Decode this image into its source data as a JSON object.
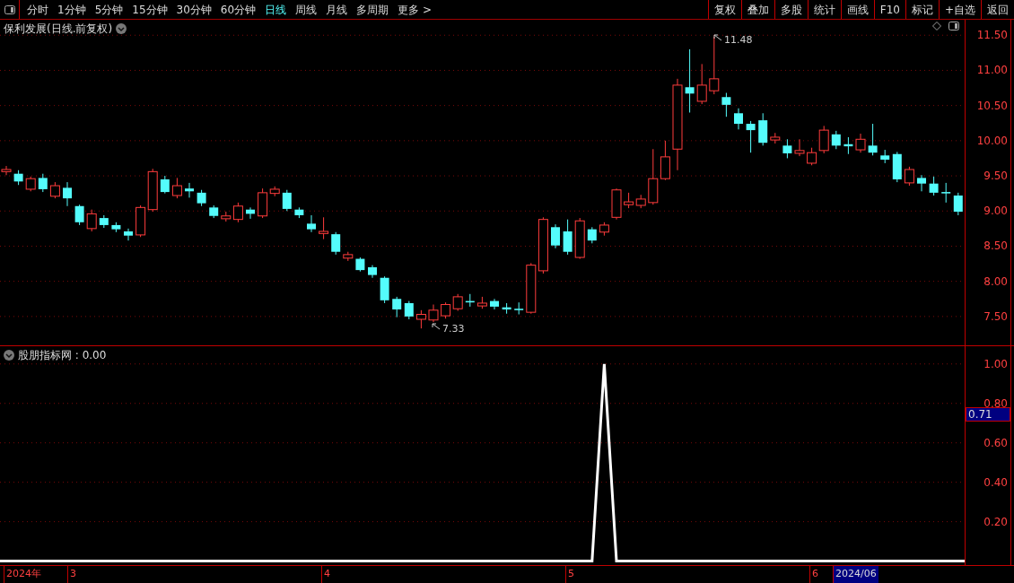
{
  "toolbar": {
    "periods": [
      {
        "label": "分时",
        "selected": false
      },
      {
        "label": "1分钟",
        "selected": false
      },
      {
        "label": "5分钟",
        "selected": false
      },
      {
        "label": "15分钟",
        "selected": false
      },
      {
        "label": "30分钟",
        "selected": false
      },
      {
        "label": "60分钟",
        "selected": false
      },
      {
        "label": "日线",
        "selected": true
      },
      {
        "label": "周线",
        "selected": false
      },
      {
        "label": "月线",
        "selected": false
      },
      {
        "label": "多周期",
        "selected": false
      },
      {
        "label": "更多 >",
        "selected": false
      }
    ],
    "actions": [
      "复权",
      "叠加",
      "多股",
      "统计",
      "画线",
      "F10",
      "标记",
      "+自选",
      "返回"
    ]
  },
  "price_chart": {
    "title": "保利发展(日线.前复权)",
    "high_marker": "11.48",
    "low_marker": "7.33",
    "chart_data": {
      "type": "candlestick",
      "grid": true,
      "ylim": [
        7.09,
        11.72
      ],
      "yticks": [
        {
          "value": 11.5,
          "label": "11.50"
        },
        {
          "value": 11,
          "label": "11.00"
        },
        {
          "value": 10.5,
          "label": "10.50"
        },
        {
          "value": 10,
          "label": "10.00"
        },
        {
          "value": 9.5,
          "label": "9.50"
        },
        {
          "value": 9,
          "label": "9.00"
        },
        {
          "value": 8.5,
          "label": "8.50"
        },
        {
          "value": 8,
          "label": "8.00"
        },
        {
          "value": 7.5,
          "label": "7.50"
        }
      ],
      "ohlc": [
        [
          9.56,
          9.64,
          9.51,
          9.59
        ],
        [
          9.53,
          9.58,
          9.37,
          9.42
        ],
        [
          9.31,
          9.49,
          9.28,
          9.46
        ],
        [
          9.47,
          9.53,
          9.27,
          9.31
        ],
        [
          9.21,
          9.41,
          9.18,
          9.36
        ],
        [
          9.33,
          9.41,
          9.07,
          9.18
        ],
        [
          9.07,
          9.09,
          8.8,
          8.84
        ],
        [
          8.75,
          9.02,
          8.71,
          8.96
        ],
        [
          8.9,
          8.94,
          8.76,
          8.8
        ],
        [
          8.8,
          8.84,
          8.7,
          8.74
        ],
        [
          8.71,
          8.75,
          8.58,
          8.65
        ],
        [
          8.66,
          9.08,
          8.63,
          9.05
        ],
        [
          9.02,
          9.6,
          8.99,
          9.56
        ],
        [
          9.45,
          9.5,
          9.25,
          9.27
        ],
        [
          9.22,
          9.47,
          9.18,
          9.36
        ],
        [
          9.32,
          9.4,
          9.19,
          9.28
        ],
        [
          9.26,
          9.3,
          9.07,
          9.11
        ],
        [
          9.05,
          9.08,
          8.9,
          8.93
        ],
        [
          8.89,
          8.99,
          8.85,
          8.93
        ],
        [
          8.88,
          9.12,
          8.84,
          9.07
        ],
        [
          9.02,
          9.05,
          8.89,
          8.96
        ],
        [
          8.93,
          9.32,
          8.9,
          9.26
        ],
        [
          9.25,
          9.35,
          9.21,
          9.31
        ],
        [
          9.26,
          9.3,
          9.0,
          9.03
        ],
        [
          9.02,
          9.05,
          8.9,
          8.94
        ],
        [
          8.82,
          8.94,
          8.7,
          8.74
        ],
        [
          8.68,
          8.91,
          8.6,
          8.71
        ],
        [
          8.67,
          8.7,
          8.38,
          8.42
        ],
        [
          8.33,
          8.42,
          8.29,
          8.38
        ],
        [
          8.32,
          8.34,
          8.14,
          8.16
        ],
        [
          8.2,
          8.23,
          8.05,
          8.09
        ],
        [
          8.05,
          8.07,
          7.69,
          7.73
        ],
        [
          7.75,
          7.78,
          7.49,
          7.6
        ],
        [
          7.69,
          7.72,
          7.46,
          7.5
        ],
        [
          7.46,
          7.59,
          7.33,
          7.53
        ],
        [
          7.45,
          7.67,
          7.42,
          7.59
        ],
        [
          7.51,
          7.7,
          7.47,
          7.67
        ],
        [
          7.61,
          7.82,
          7.58,
          7.78
        ],
        [
          7.72,
          7.82,
          7.64,
          7.7
        ],
        [
          7.65,
          7.78,
          7.61,
          7.69
        ],
        [
          7.72,
          7.75,
          7.6,
          7.64
        ],
        [
          7.63,
          7.69,
          7.54,
          7.6
        ],
        [
          7.61,
          7.7,
          7.53,
          7.59
        ],
        [
          7.56,
          8.26,
          7.54,
          8.23
        ],
        [
          8.15,
          8.91,
          8.11,
          8.88
        ],
        [
          8.77,
          8.81,
          8.47,
          8.51
        ],
        [
          8.71,
          8.88,
          8.38,
          8.42
        ],
        [
          8.34,
          8.9,
          8.32,
          8.86
        ],
        [
          8.74,
          8.77,
          8.54,
          8.58
        ],
        [
          8.7,
          8.84,
          8.65,
          8.8
        ],
        [
          8.91,
          9.32,
          8.88,
          9.3
        ],
        [
          9.09,
          9.26,
          9.04,
          9.13
        ],
        [
          9.08,
          9.23,
          9.04,
          9.17
        ],
        [
          9.12,
          9.88,
          9.09,
          9.46
        ],
        [
          9.46,
          10.0,
          9.44,
          9.77
        ],
        [
          9.88,
          10.88,
          9.58,
          10.79
        ],
        [
          10.76,
          11.3,
          10.4,
          10.67
        ],
        [
          10.56,
          11.09,
          10.52,
          10.79
        ],
        [
          10.71,
          11.48,
          10.66,
          10.88
        ],
        [
          10.62,
          10.68,
          10.34,
          10.51
        ],
        [
          10.39,
          10.46,
          10.16,
          10.24
        ],
        [
          10.24,
          10.28,
          9.83,
          10.15
        ],
        [
          10.29,
          10.39,
          9.93,
          9.97
        ],
        [
          10.01,
          10.11,
          9.96,
          10.05
        ],
        [
          9.93,
          10.02,
          9.75,
          9.82
        ],
        [
          9.82,
          10.02,
          9.78,
          9.86
        ],
        [
          9.68,
          9.9,
          9.65,
          9.83
        ],
        [
          9.86,
          10.21,
          9.82,
          10.15
        ],
        [
          10.09,
          10.14,
          9.88,
          9.93
        ],
        [
          9.95,
          10.05,
          9.81,
          9.92
        ],
        [
          9.87,
          10.1,
          9.83,
          10.02
        ],
        [
          9.93,
          10.24,
          9.79,
          9.83
        ],
        [
          9.79,
          9.87,
          9.68,
          9.73
        ],
        [
          9.81,
          9.84,
          9.41,
          9.45
        ],
        [
          9.4,
          9.63,
          9.36,
          9.59
        ],
        [
          9.47,
          9.51,
          9.28,
          9.39
        ],
        [
          9.39,
          9.49,
          9.22,
          9.26
        ],
        [
          9.27,
          9.4,
          9.12,
          9.25
        ],
        [
          9.22,
          9.26,
          8.94,
          8.99
        ]
      ]
    }
  },
  "indicator": {
    "legend": "股朋指标网 : 0.00",
    "cursor_value": "0.71",
    "chart_data": {
      "type": "line",
      "grid": true,
      "ylim": [
        -0.02,
        1.09
      ],
      "yticks": [
        {
          "value": 1,
          "label": "1.00"
        },
        {
          "value": 0.8,
          "label": "0.80"
        },
        {
          "value": 0.6,
          "label": "0.60"
        },
        {
          "value": 0.4,
          "label": "0.40"
        },
        {
          "value": 0.2,
          "label": "0.20"
        }
      ],
      "values": [
        0,
        0,
        0,
        0,
        0,
        0,
        0,
        0,
        0,
        0,
        0,
        0,
        0,
        0,
        0,
        0,
        0,
        0,
        0,
        0,
        0,
        0,
        0,
        0,
        0,
        0,
        0,
        0,
        0,
        0,
        0,
        0,
        0,
        0,
        0,
        0,
        0,
        0,
        0,
        0,
        0,
        0,
        0,
        0,
        0,
        0,
        0,
        0,
        0,
        1,
        0,
        0,
        0,
        0,
        0,
        0,
        0,
        0,
        0,
        0,
        0,
        0,
        0,
        0,
        0,
        0,
        0,
        0,
        0,
        0,
        0,
        0,
        0,
        0,
        0,
        0,
        0,
        0,
        0
      ]
    }
  },
  "date_axis": [
    "2024年",
    "3",
    "4",
    "5",
    "6"
  ],
  "cursor_date": "2024/06"
}
